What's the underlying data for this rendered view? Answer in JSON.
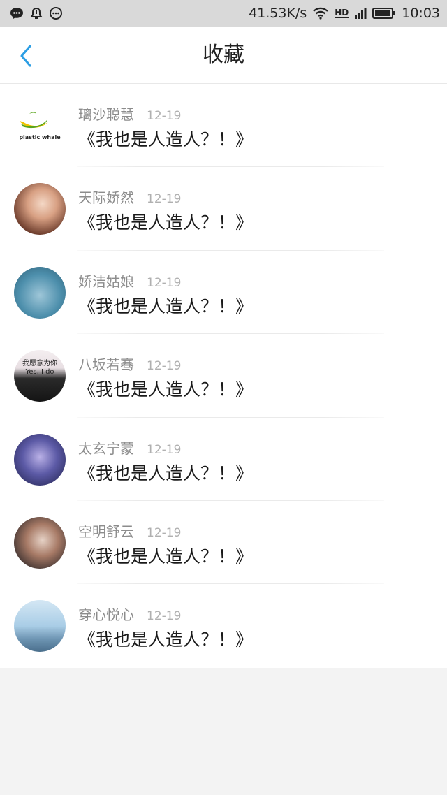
{
  "status_bar": {
    "speed": "41.53K/s",
    "network_label": "HD",
    "time": "10:03",
    "icons": [
      "chat-icon",
      "alarm-icon",
      "more-icon",
      "wifi-icon",
      "signal-icon",
      "battery-icon"
    ]
  },
  "nav": {
    "title": "收藏",
    "back_icon": "chevron-left-icon",
    "accent": "#2c9ee4"
  },
  "list": {
    "items": [
      {
        "name": "璃沙聪慧",
        "date": "12-19",
        "title": "《我也是人造人？！》",
        "avatar_text": "plastic whale"
      },
      {
        "name": "天际娇然",
        "date": "12-19",
        "title": "《我也是人造人？！》"
      },
      {
        "name": "娇洁姑娘",
        "date": "12-19",
        "title": "《我也是人造人？！》"
      },
      {
        "name": "八坂若骞",
        "date": "12-19",
        "title": "《我也是人造人？！》",
        "avatar_text": "我愿意为你 Yes, I do"
      },
      {
        "name": "太玄宁蒙",
        "date": "12-19",
        "title": "《我也是人造人？！》"
      },
      {
        "name": "空明舒云",
        "date": "12-19",
        "title": "《我也是人造人？！》"
      },
      {
        "name": "穿心悦心",
        "date": "12-19",
        "title": "《我也是人造人？！》"
      }
    ]
  }
}
